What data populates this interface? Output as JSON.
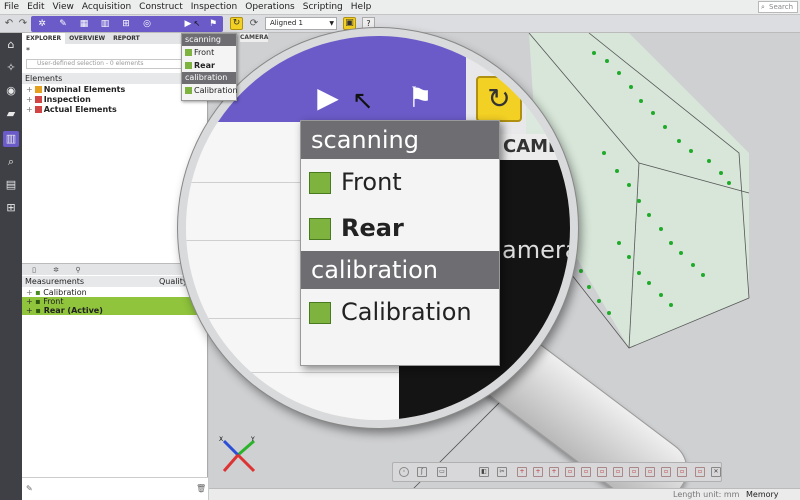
{
  "menubar": {
    "items": [
      "File",
      "Edit",
      "View",
      "Acquisition",
      "Construct",
      "Inspection",
      "Operations",
      "Scripting",
      "Help"
    ],
    "search_placeholder": "Search"
  },
  "toolbar": {
    "alignment_select": "Aligned 1",
    "help_label": "?"
  },
  "explorer": {
    "tabs": [
      "EXPLORER",
      "OVERVIEW",
      "REPORT"
    ],
    "star": "*",
    "filter_placeholder": "User-defined selection - 0 elements",
    "elements_header": "Elements",
    "tree": [
      {
        "label": "Nominal Elements",
        "color": "#e6a020"
      },
      {
        "label": "Inspection",
        "color": "#d24545"
      },
      {
        "label": "Actual Elements",
        "color": "#d24545"
      }
    ]
  },
  "measurements": {
    "header": "Measurements",
    "quality_header": "Quality",
    "rows": [
      {
        "label": "Calibration",
        "highlight": false
      },
      {
        "label": "Front",
        "highlight": true
      },
      {
        "label": "Rear (Active)",
        "highlight": true
      }
    ]
  },
  "scan_menu": {
    "groups": [
      {
        "title": "scanning",
        "items": [
          "Front",
          "Rear"
        ]
      },
      {
        "title": "calibration",
        "items": [
          "Calibration"
        ]
      }
    ],
    "bold_item": "Rear"
  },
  "viewport": {
    "camera_tab": "CAMERA",
    "camera_text": "amera",
    "axis_labels": [
      "X",
      "Y"
    ]
  },
  "status": {
    "length_unit": "Length unit: mm",
    "memory": "Memory usage"
  },
  "colors": {
    "accent": "#6a5bc8",
    "highlight_green": "#8fc43c",
    "yellow": "#f3d024",
    "point_green": "#1faa2a"
  }
}
